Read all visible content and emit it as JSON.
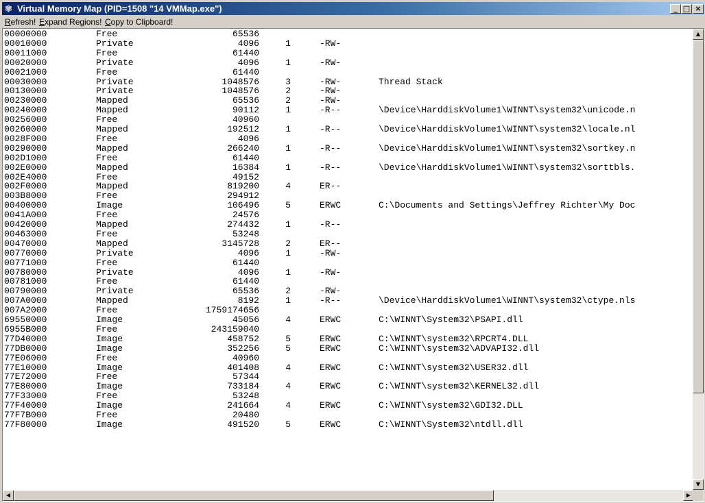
{
  "window": {
    "title": "Virtual Memory Map (PID=1508 \"14 VMMap.exe\")",
    "controls": {
      "minimize": "_",
      "maximize": "□",
      "close": "×"
    }
  },
  "menu": [
    {
      "label": "Refresh!",
      "accel": "R",
      "rest": "efresh!"
    },
    {
      "label": "Expand Regions!",
      "accel": "E",
      "rest": "xpand Regions!"
    },
    {
      "label": "Copy to Clipboard!",
      "accel": "C",
      "rest": "opy to Clipboard!"
    }
  ],
  "regions": [
    {
      "addr": "00000000",
      "type": "Free",
      "size": "65536",
      "blocks": "",
      "prot": "",
      "desc": ""
    },
    {
      "addr": "00010000",
      "type": "Private",
      "size": "4096",
      "blocks": "1",
      "prot": "-RW-",
      "desc": ""
    },
    {
      "addr": "00011000",
      "type": "Free",
      "size": "61440",
      "blocks": "",
      "prot": "",
      "desc": ""
    },
    {
      "addr": "00020000",
      "type": "Private",
      "size": "4096",
      "blocks": "1",
      "prot": "-RW-",
      "desc": ""
    },
    {
      "addr": "00021000",
      "type": "Free",
      "size": "61440",
      "blocks": "",
      "prot": "",
      "desc": ""
    },
    {
      "addr": "00030000",
      "type": "Private",
      "size": "1048576",
      "blocks": "3",
      "prot": "-RW-",
      "desc": "Thread Stack"
    },
    {
      "addr": "00130000",
      "type": "Private",
      "size": "1048576",
      "blocks": "2",
      "prot": "-RW-",
      "desc": ""
    },
    {
      "addr": "00230000",
      "type": "Mapped",
      "size": "65536",
      "blocks": "2",
      "prot": "-RW-",
      "desc": ""
    },
    {
      "addr": "00240000",
      "type": "Mapped",
      "size": "90112",
      "blocks": "1",
      "prot": "-R--",
      "desc": "\\Device\\HarddiskVolume1\\WINNT\\system32\\unicode.n"
    },
    {
      "addr": "00256000",
      "type": "Free",
      "size": "40960",
      "blocks": "",
      "prot": "",
      "desc": ""
    },
    {
      "addr": "00260000",
      "type": "Mapped",
      "size": "192512",
      "blocks": "1",
      "prot": "-R--",
      "desc": "\\Device\\HarddiskVolume1\\WINNT\\system32\\locale.nl"
    },
    {
      "addr": "0028F000",
      "type": "Free",
      "size": "4096",
      "blocks": "",
      "prot": "",
      "desc": ""
    },
    {
      "addr": "00290000",
      "type": "Mapped",
      "size": "266240",
      "blocks": "1",
      "prot": "-R--",
      "desc": "\\Device\\HarddiskVolume1\\WINNT\\system32\\sortkey.n"
    },
    {
      "addr": "002D1000",
      "type": "Free",
      "size": "61440",
      "blocks": "",
      "prot": "",
      "desc": ""
    },
    {
      "addr": "002E0000",
      "type": "Mapped",
      "size": "16384",
      "blocks": "1",
      "prot": "-R--",
      "desc": "\\Device\\HarddiskVolume1\\WINNT\\system32\\sorttbls."
    },
    {
      "addr": "002E4000",
      "type": "Free",
      "size": "49152",
      "blocks": "",
      "prot": "",
      "desc": ""
    },
    {
      "addr": "002F0000",
      "type": "Mapped",
      "size": "819200",
      "blocks": "4",
      "prot": "ER--",
      "desc": ""
    },
    {
      "addr": "003B8000",
      "type": "Free",
      "size": "294912",
      "blocks": "",
      "prot": "",
      "desc": ""
    },
    {
      "addr": "00400000",
      "type": "Image",
      "size": "106496",
      "blocks": "5",
      "prot": "ERWC",
      "desc": "C:\\Documents and Settings\\Jeffrey Richter\\My Doc"
    },
    {
      "addr": "0041A000",
      "type": "Free",
      "size": "24576",
      "blocks": "",
      "prot": "",
      "desc": ""
    },
    {
      "addr": "00420000",
      "type": "Mapped",
      "size": "274432",
      "blocks": "1",
      "prot": "-R--",
      "desc": ""
    },
    {
      "addr": "00463000",
      "type": "Free",
      "size": "53248",
      "blocks": "",
      "prot": "",
      "desc": ""
    },
    {
      "addr": "00470000",
      "type": "Mapped",
      "size": "3145728",
      "blocks": "2",
      "prot": "ER--",
      "desc": ""
    },
    {
      "addr": "00770000",
      "type": "Private",
      "size": "4096",
      "blocks": "1",
      "prot": "-RW-",
      "desc": ""
    },
    {
      "addr": "00771000",
      "type": "Free",
      "size": "61440",
      "blocks": "",
      "prot": "",
      "desc": ""
    },
    {
      "addr": "00780000",
      "type": "Private",
      "size": "4096",
      "blocks": "1",
      "prot": "-RW-",
      "desc": ""
    },
    {
      "addr": "00781000",
      "type": "Free",
      "size": "61440",
      "blocks": "",
      "prot": "",
      "desc": ""
    },
    {
      "addr": "00790000",
      "type": "Private",
      "size": "65536",
      "blocks": "2",
      "prot": "-RW-",
      "desc": ""
    },
    {
      "addr": "007A0000",
      "type": "Mapped",
      "size": "8192",
      "blocks": "1",
      "prot": "-R--",
      "desc": "\\Device\\HarddiskVolume1\\WINNT\\system32\\ctype.nls"
    },
    {
      "addr": "007A2000",
      "type": "Free",
      "size": "1759174656",
      "blocks": "",
      "prot": "",
      "desc": ""
    },
    {
      "addr": "69550000",
      "type": "Image",
      "size": "45056",
      "blocks": "4",
      "prot": "ERWC",
      "desc": "C:\\WINNT\\System32\\PSAPI.dll"
    },
    {
      "addr": "6955B000",
      "type": "Free",
      "size": "243159040",
      "blocks": "",
      "prot": "",
      "desc": ""
    },
    {
      "addr": "77D40000",
      "type": "Image",
      "size": "458752",
      "blocks": "5",
      "prot": "ERWC",
      "desc": "C:\\WINNT\\system32\\RPCRT4.DLL"
    },
    {
      "addr": "77DB0000",
      "type": "Image",
      "size": "352256",
      "blocks": "5",
      "prot": "ERWC",
      "desc": "C:\\WINNT\\system32\\ADVAPI32.dll"
    },
    {
      "addr": "77E06000",
      "type": "Free",
      "size": "40960",
      "blocks": "",
      "prot": "",
      "desc": ""
    },
    {
      "addr": "77E10000",
      "type": "Image",
      "size": "401408",
      "blocks": "4",
      "prot": "ERWC",
      "desc": "C:\\WINNT\\system32\\USER32.dll"
    },
    {
      "addr": "77E72000",
      "type": "Free",
      "size": "57344",
      "blocks": "",
      "prot": "",
      "desc": ""
    },
    {
      "addr": "77E80000",
      "type": "Image",
      "size": "733184",
      "blocks": "4",
      "prot": "ERWC",
      "desc": "C:\\WINNT\\system32\\KERNEL32.dll"
    },
    {
      "addr": "77F33000",
      "type": "Free",
      "size": "53248",
      "blocks": "",
      "prot": "",
      "desc": ""
    },
    {
      "addr": "77F40000",
      "type": "Image",
      "size": "241664",
      "blocks": "4",
      "prot": "ERWC",
      "desc": "C:\\WINNT\\system32\\GDI32.DLL"
    },
    {
      "addr": "77F7B000",
      "type": "Free",
      "size": "20480",
      "blocks": "",
      "prot": "",
      "desc": ""
    },
    {
      "addr": "77F80000",
      "type": "Image",
      "size": "491520",
      "blocks": "5",
      "prot": "ERWC",
      "desc": "C:\\WINNT\\System32\\ntdll.dll"
    }
  ],
  "icons": {
    "app": "vmmap-app-icon",
    "scroll_up": "arrow-up-icon",
    "scroll_down": "arrow-down-icon",
    "scroll_left": "arrow-left-icon",
    "scroll_right": "arrow-right-icon"
  },
  "colors": {
    "title_start": "#0a246a",
    "title_end": "#a6caf0",
    "face": "#d4d0c8",
    "list_bg": "#ffffff"
  }
}
